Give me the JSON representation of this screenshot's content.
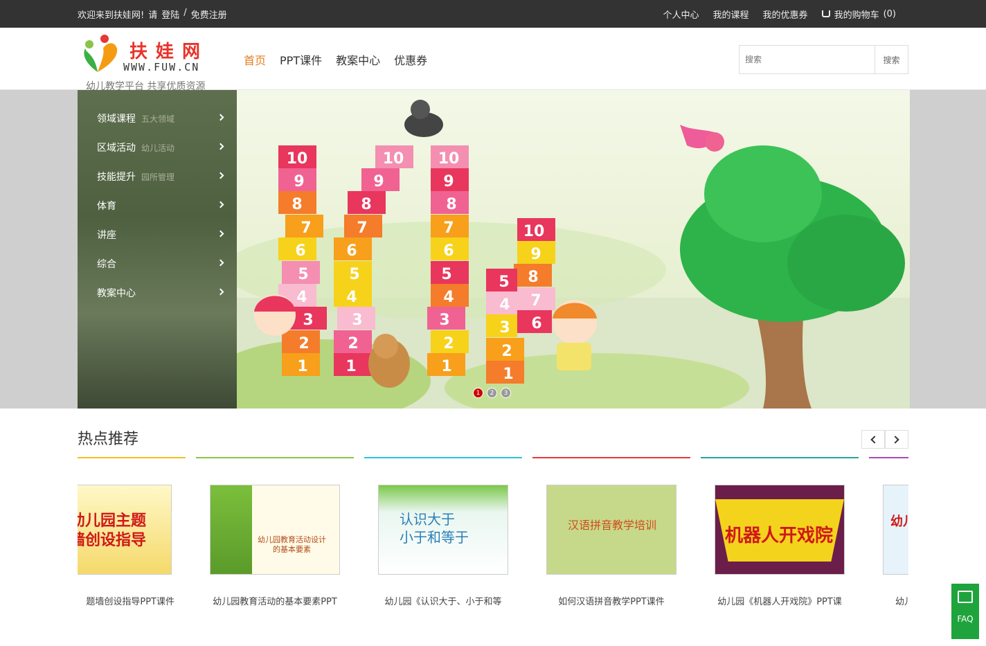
{
  "topbar": {
    "welcome": "欢迎来到扶娃网!",
    "please": "请",
    "login": "登陆",
    "sep": "/",
    "register": "免费注册",
    "links": [
      "个人中心",
      "我的课程",
      "我的优惠券"
    ],
    "cart": "我的购物车",
    "cart_count": "(0)"
  },
  "logo": {
    "name": "扶娃网",
    "url": "WWW.FUW.CN",
    "slogan": "幼儿教学平台 共享优质资源"
  },
  "nav": [
    "首页",
    "PPT课件",
    "教案中心",
    "优惠券"
  ],
  "search": {
    "placeholder": "搜索",
    "button": "搜索"
  },
  "sidebar": [
    {
      "label": "领域课程",
      "sub": "五大领域"
    },
    {
      "label": "区域活动",
      "sub": "幼儿活动"
    },
    {
      "label": "技能提升",
      "sub": "园所管理"
    },
    {
      "label": "体育",
      "sub": ""
    },
    {
      "label": "讲座",
      "sub": ""
    },
    {
      "label": "综合",
      "sub": ""
    },
    {
      "label": "教案中心",
      "sub": ""
    }
  ],
  "carousel": {
    "dots": [
      "1",
      "2",
      "3"
    ],
    "active": 1
  },
  "hot": {
    "title": "热点推荐",
    "cards": [
      {
        "caption": "题墙创设指导PPT课件",
        "thumb_text": "幼儿园主题\n墙创设指导",
        "color": "#f0c020"
      },
      {
        "caption": "幼儿园教育活动的基本要素PPT",
        "thumb_text": "幼儿园教育活动设计\n的基本要素",
        "color": "#8bc34a"
      },
      {
        "caption": "幼儿园《认识大于、小于和等",
        "thumb_text": "认识大于\n小于和等于",
        "color": "#26c6da"
      },
      {
        "caption": "如何汉语拼音教学PPT课件",
        "thumb_text": "汉语拼音教学培训",
        "color": "#e53935"
      },
      {
        "caption": "幼儿园《机器人开戏院》PPT课",
        "thumb_text": "机器人开戏院",
        "color": "#26a69a"
      },
      {
        "caption": "幼儿",
        "thumb_text": "幼儿",
        "color": "#ab47bc"
      }
    ]
  },
  "faq": "FAQ"
}
